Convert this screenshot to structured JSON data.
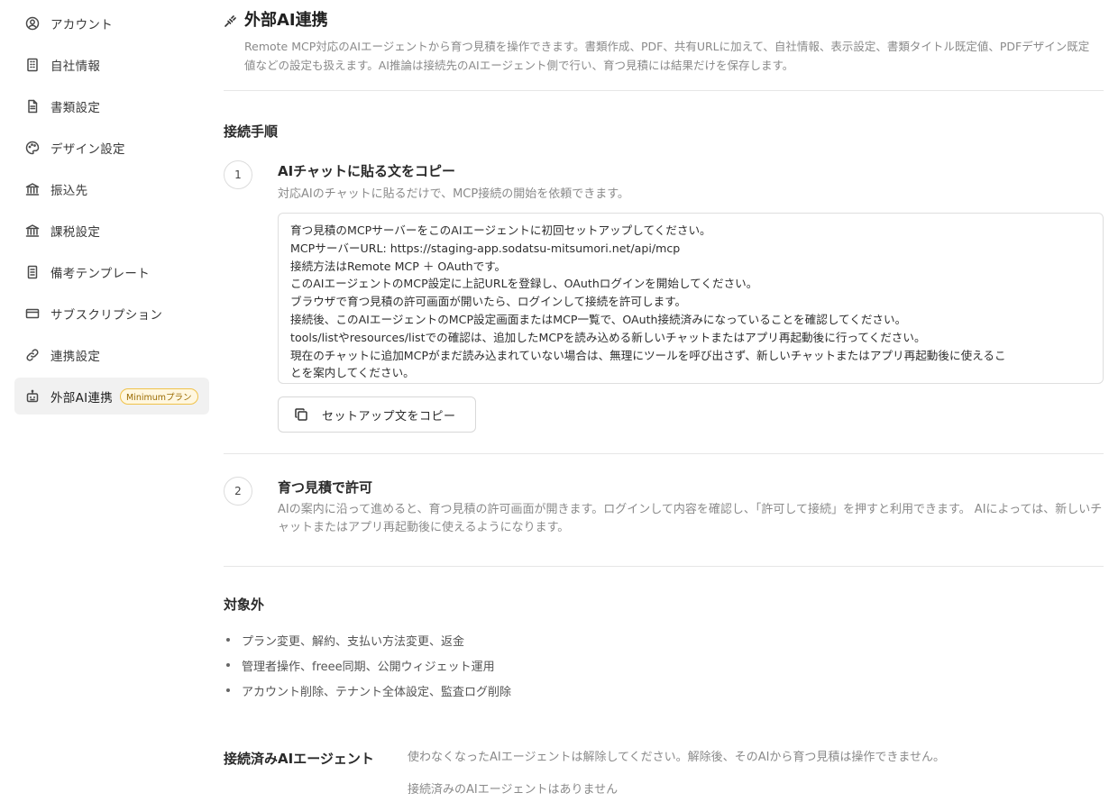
{
  "sidebar": {
    "items": [
      {
        "label": "アカウント",
        "icon": "user-circle-icon"
      },
      {
        "label": "自社情報",
        "icon": "building-icon"
      },
      {
        "label": "書類設定",
        "icon": "document-icon"
      },
      {
        "label": "デザイン設定",
        "icon": "palette-icon"
      },
      {
        "label": "振込先",
        "icon": "bank-icon"
      },
      {
        "label": "課税設定",
        "icon": "bank-icon"
      },
      {
        "label": "備考テンプレート",
        "icon": "notes-icon"
      },
      {
        "label": "サブスクリプション",
        "icon": "credit-card-icon"
      },
      {
        "label": "連携設定",
        "icon": "link-icon"
      },
      {
        "label": "外部AI連携",
        "icon": "robot-icon",
        "badge": "Minimumプラン",
        "active": true
      }
    ]
  },
  "header": {
    "title": "外部AI連携",
    "description": "Remote MCP対応のAIエージェントから育つ見積を操作できます。書類作成、PDF、共有URLに加えて、自社情報、表示設定、書類タイトル既定値、PDFデザイン既定値などの設定も扱えます。AI推論は接続先のAIエージェント側で行い、育つ見積には結果だけを保存します。"
  },
  "steps_section": {
    "title": "接続手順",
    "step1": {
      "number": "1",
      "title": "AIチャットに貼る文をコピー",
      "description": "対応AIのチャットに貼るだけで、MCP接続の開始を依頼できます。",
      "setup_text": [
        "育つ見積のMCPサーバーをこのAIエージェントに初回セットアップしてください。",
        "MCPサーバーURL: https://staging-app.sodatsu-mitsumori.net/api/mcp",
        "接続方法はRemote MCP ＋ OAuthです。",
        "このAIエージェントのMCP設定に上記URLを登録し、OAuthログインを開始してください。",
        "ブラウザで育つ見積の許可画面が開いたら、ログインして接続を許可します。",
        "接続後、このAIエージェントのMCP設定画面またはMCP一覧で、OAuth接続済みになっていることを確認してください。",
        "tools/listやresources/listでの確認は、追加したMCPを読み込める新しいチャットまたはアプリ再起動後に行ってください。",
        "現在のチャットに追加MCPがまだ読み込まれていない場合は、無理にツールを呼び出さず、新しいチャットまたはアプリ再起動後に使えるこ",
        "とを案内してください。"
      ],
      "copy_button": "セットアップ文をコピー"
    },
    "step2": {
      "number": "2",
      "title": "育つ見積で許可",
      "description": "AIの案内に沿って進めると、育つ見積の許可画面が開きます。ログインして内容を確認し、「許可して接続」を押すと利用できます。 AIによっては、新しいチャットまたはアプリ再起動後に使えるようになります。"
    }
  },
  "excluded": {
    "title": "対象外",
    "items": [
      "プラン変更、解約、支払い方法変更、返金",
      "管理者操作、freee同期、公開ウィジェット運用",
      "アカウント削除、テナント全体設定、監査ログ削除"
    ]
  },
  "connected_agents": {
    "title": "接続済みAIエージェント",
    "description": "使わなくなったAIエージェントは解除してください。解除後、そのAIから育つ見積は操作できません。",
    "empty_message": "接続済みのAIエージェントはありません"
  }
}
